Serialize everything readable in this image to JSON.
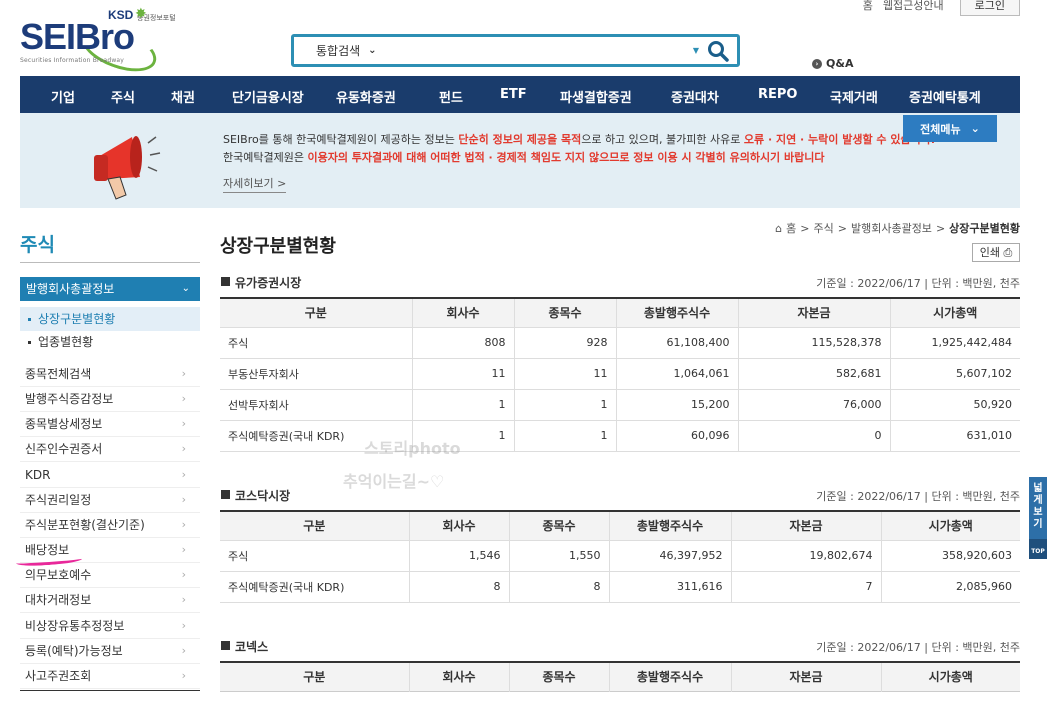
{
  "util": {
    "home": "홈",
    "access": "웹접근성안내",
    "login": "로그인"
  },
  "logo": {
    "ksd": "KSD",
    "ksd_sub": "증권정보포털",
    "brand_a": "SEI",
    "brand_b": "Bro",
    "subtitle": "Securities Information Broadway"
  },
  "search": {
    "scope": "통합검색"
  },
  "qa": "Q&A",
  "gnb": [
    "기업",
    "주식",
    "채권",
    "단기금융시장",
    "유동화증권",
    "펀드",
    "ETF",
    "파생결합증권",
    "증권대차",
    "REPO",
    "국제거래",
    "증권예탁통계"
  ],
  "notice": {
    "l1_a": "SEIBro를 통해 한국예탁결제원이 제공하는 정보는 ",
    "l1_b": "단순히 정보의 제공을 목적",
    "l1_c": "으로 하고 있으며, 불가피한 사유로 ",
    "l1_d": "오류 · 지연 · 누락이 발생할 수 있습니다.",
    "l2_a": "한국예탁결제원은 ",
    "l2_b": "이용자의 투자결과에 대해 어떠한 법적 · 경제적 책임도 지지 않으므로 정보 이용 시 각별히 유의하시기 바랍니다",
    "more": "자세히보기  >",
    "allmenu": "전체메뉴"
  },
  "sidebar": {
    "title": "주식",
    "selected": "발행회사총괄정보",
    "subs": [
      "상장구분별현황",
      "업종별현황"
    ],
    "items": [
      "종목전체검색",
      "발행주식증감정보",
      "종목별상세정보",
      "신주인수권증서",
      "KDR",
      "주식권리일정",
      "주식분포현황(결산기준)",
      "배당정보",
      "의무보호예수",
      "대차거래정보",
      "비상장유통추정정보",
      "등록(예탁)가능정보",
      "사고주권조회"
    ]
  },
  "breadcrumb": {
    "home": "홈",
    "c1": "주식",
    "c2": "발행회사총괄정보",
    "c3": "상장구분별현황"
  },
  "page_title": "상장구분별현황",
  "print": "인쇄",
  "columns": [
    "구분",
    "회사수",
    "종목수",
    "총발행주식수",
    "자본금",
    "시가총액"
  ],
  "sections": [
    {
      "name": "유가증권시장",
      "meta": "기준일 : 2022/06/17  |  단위 : 백만원, 천주",
      "rows": [
        [
          "주식",
          "808",
          "928",
          "61,108,400",
          "115,528,378",
          "1,925,442,484"
        ],
        [
          "부동산투자회사",
          "11",
          "11",
          "1,064,061",
          "582,681",
          "5,607,102"
        ],
        [
          "선박투자회사",
          "1",
          "1",
          "15,200",
          "76,000",
          "50,920"
        ],
        [
          "주식예탁증권(국내 KDR)",
          "1",
          "1",
          "60,096",
          "0",
          "631,010"
        ]
      ]
    },
    {
      "name": "코스닥시장",
      "meta": "기준일 : 2022/06/17  |  단위 : 백만원, 천주",
      "rows": [
        [
          "주식",
          "1,546",
          "1,550",
          "46,397,952",
          "19,802,674",
          "358,920,603"
        ],
        [
          "주식예탁증권(국내 KDR)",
          "8",
          "8",
          "311,616",
          "7",
          "2,085,960"
        ]
      ]
    },
    {
      "name": "코넥스",
      "meta": "기준일 : 2022/06/17  |  단위 : 백만원, 천주",
      "rows": []
    }
  ],
  "watermark": {
    "l1": "스토리photo",
    "l2": "추억이는길~♡"
  },
  "float": {
    "label": "넓게보기",
    "top": "TOP"
  },
  "colors": {
    "nav": "#1a3c6c",
    "accent": "#1f7fb2",
    "warning": "#e23a2e",
    "marker": "#e8289a"
  }
}
